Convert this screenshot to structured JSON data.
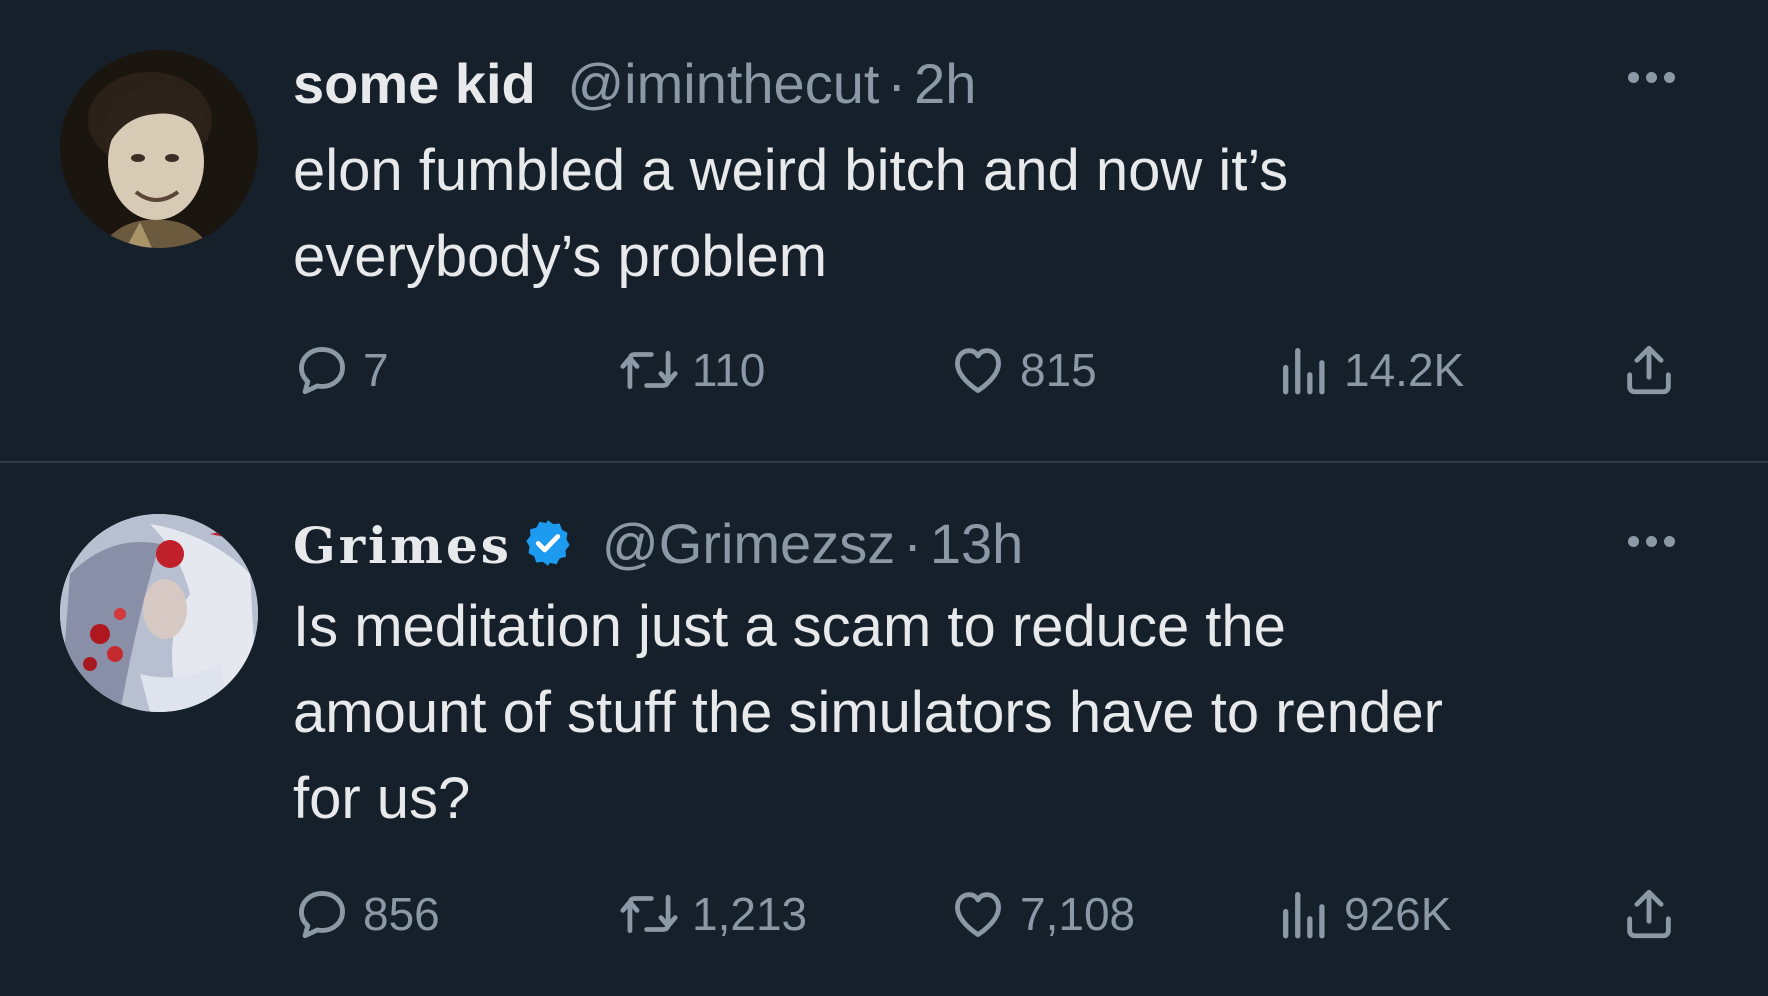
{
  "tweets": [
    {
      "display_name": "some kid",
      "handle": "@iminthecut",
      "separator": "·",
      "time": "2h",
      "verified": false,
      "text_lines": [
        "elon fumbled a weird bitch and now it’s",
        "everybody’s problem"
      ],
      "replies": "7",
      "retweets": "110",
      "likes": "815",
      "views": "14.2K"
    },
    {
      "display_name": "Grimes",
      "handle": "@Grimezsz",
      "separator": "·",
      "time": "13h",
      "verified": true,
      "text_lines": [
        "Is meditation just a scam to reduce the",
        "amount of stuff the simulators have to render",
        "for us?"
      ],
      "replies": "856",
      "retweets": "1,213",
      "likes": "7,108",
      "views": "926K"
    }
  ],
  "icons": {
    "reply": "reply-icon",
    "retweet": "retweet-icon",
    "like": "heart-icon",
    "views": "views-icon",
    "share": "share-icon",
    "more": "more-icon",
    "verified": "verified-badge-icon"
  },
  "colors": {
    "background": "#15202b",
    "text": "#e7e9ea",
    "muted": "#8b98a5",
    "verified": "#1d9bf0",
    "divider": "#2f3d4b"
  }
}
